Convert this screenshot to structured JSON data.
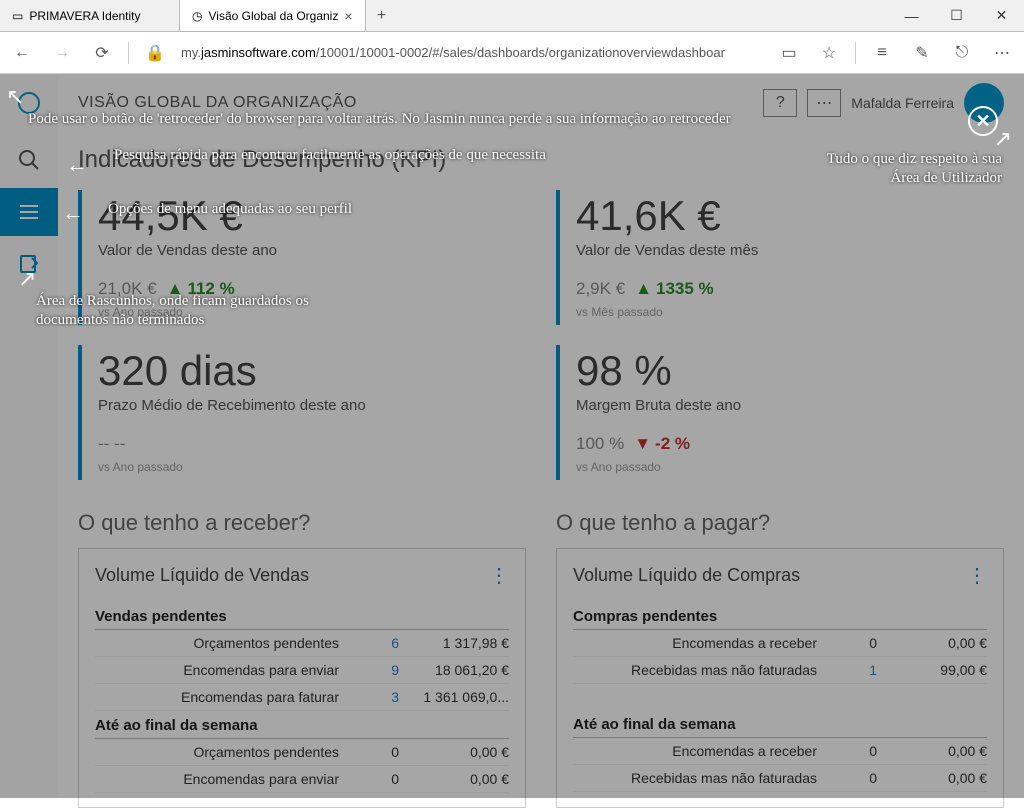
{
  "browser": {
    "tabs": [
      {
        "title": "PRIMAVERA Identity"
      },
      {
        "title": "Visão Global da Organiz"
      }
    ],
    "url_prefix": "my.",
    "url_bold": "jasminsoftware.com",
    "url_rest": "/10001/10001-0002/#/sales/dashboards/organizationoverviewdashboar"
  },
  "header": {
    "title": "VISÃO GLOBAL DA ORGANIZAÇÃO",
    "help": "?",
    "more": "⋯",
    "user": "Mafalda Ferreira"
  },
  "kpi_section_title": "Indicadores de Desempenho (KPI)",
  "kpi": [
    {
      "big": "44,5K €",
      "label": "Valor de Vendas deste ano",
      "comp_prev": "21,0K €",
      "delta": "112 %",
      "dir": "up",
      "vs": "vs Ano passado"
    },
    {
      "big": "41,6K €",
      "label": "Valor de Vendas deste mês",
      "comp_prev": "2,9K €",
      "delta": "1335 %",
      "dir": "up",
      "vs": "vs Mês passado"
    },
    {
      "big": "320 dias",
      "label": "Prazo Médio de Recebimento deste ano",
      "comp_prev": "--   --",
      "delta": "",
      "dir": "",
      "vs": "vs Ano passado"
    },
    {
      "big": "98 %",
      "label": "Margem Bruta deste ano",
      "comp_prev": "100 %",
      "delta": "-2 %",
      "dir": "down",
      "vs": "vs Ano passado"
    }
  ],
  "sub": {
    "left": "O que tenho a receber?",
    "right": "O que tenho a pagar?"
  },
  "panels": {
    "left": {
      "title": "Volume Líquido de Vendas",
      "section1": "Vendas pendentes",
      "rows1": [
        {
          "lbl": "Orçamentos pendentes",
          "cnt": "6",
          "amt": "1 317,98 €"
        },
        {
          "lbl": "Encomendas para enviar",
          "cnt": "9",
          "amt": "18 061,20 €"
        },
        {
          "lbl": "Encomendas para faturar",
          "cnt": "3",
          "amt": "1 361 069,0..."
        }
      ],
      "section2": "Até ao final da semana",
      "rows2": [
        {
          "lbl": "Orçamentos pendentes",
          "cnt": "0",
          "amt": "0,00 €"
        },
        {
          "lbl": "Encomendas para enviar",
          "cnt": "0",
          "amt": "0,00 €"
        }
      ]
    },
    "right": {
      "title": "Volume Líquido de Compras",
      "section1": "Compras pendentes",
      "rows1": [
        {
          "lbl": "Encomendas a receber",
          "cnt": "0",
          "amt": "0,00 €"
        },
        {
          "lbl": "Recebidas mas não faturadas",
          "cnt": "1",
          "amt": "99,00 €"
        }
      ],
      "section2": "Até ao final da semana",
      "rows2": [
        {
          "lbl": "Encomendas a receber",
          "cnt": "0",
          "amt": "0,00 €"
        },
        {
          "lbl": "Recebidas mas não faturadas",
          "cnt": "0",
          "amt": "0,00 €"
        }
      ]
    }
  },
  "annotations": {
    "back": "Pode usar o botão de 'retroceder' do browser para voltar atrás. No Jasmin nunca perde a sua informação ao retroceder",
    "search": "Pesquisa rápida para encontrar facilmente as operações de que necessita",
    "menu": "Opções de menu adequadas ao seu perfil",
    "drafts": "Área de Rascunhos, onde ficam guardados os documentos não terminados",
    "user": "Tudo o que diz respeito à sua Área de Utilizador"
  }
}
